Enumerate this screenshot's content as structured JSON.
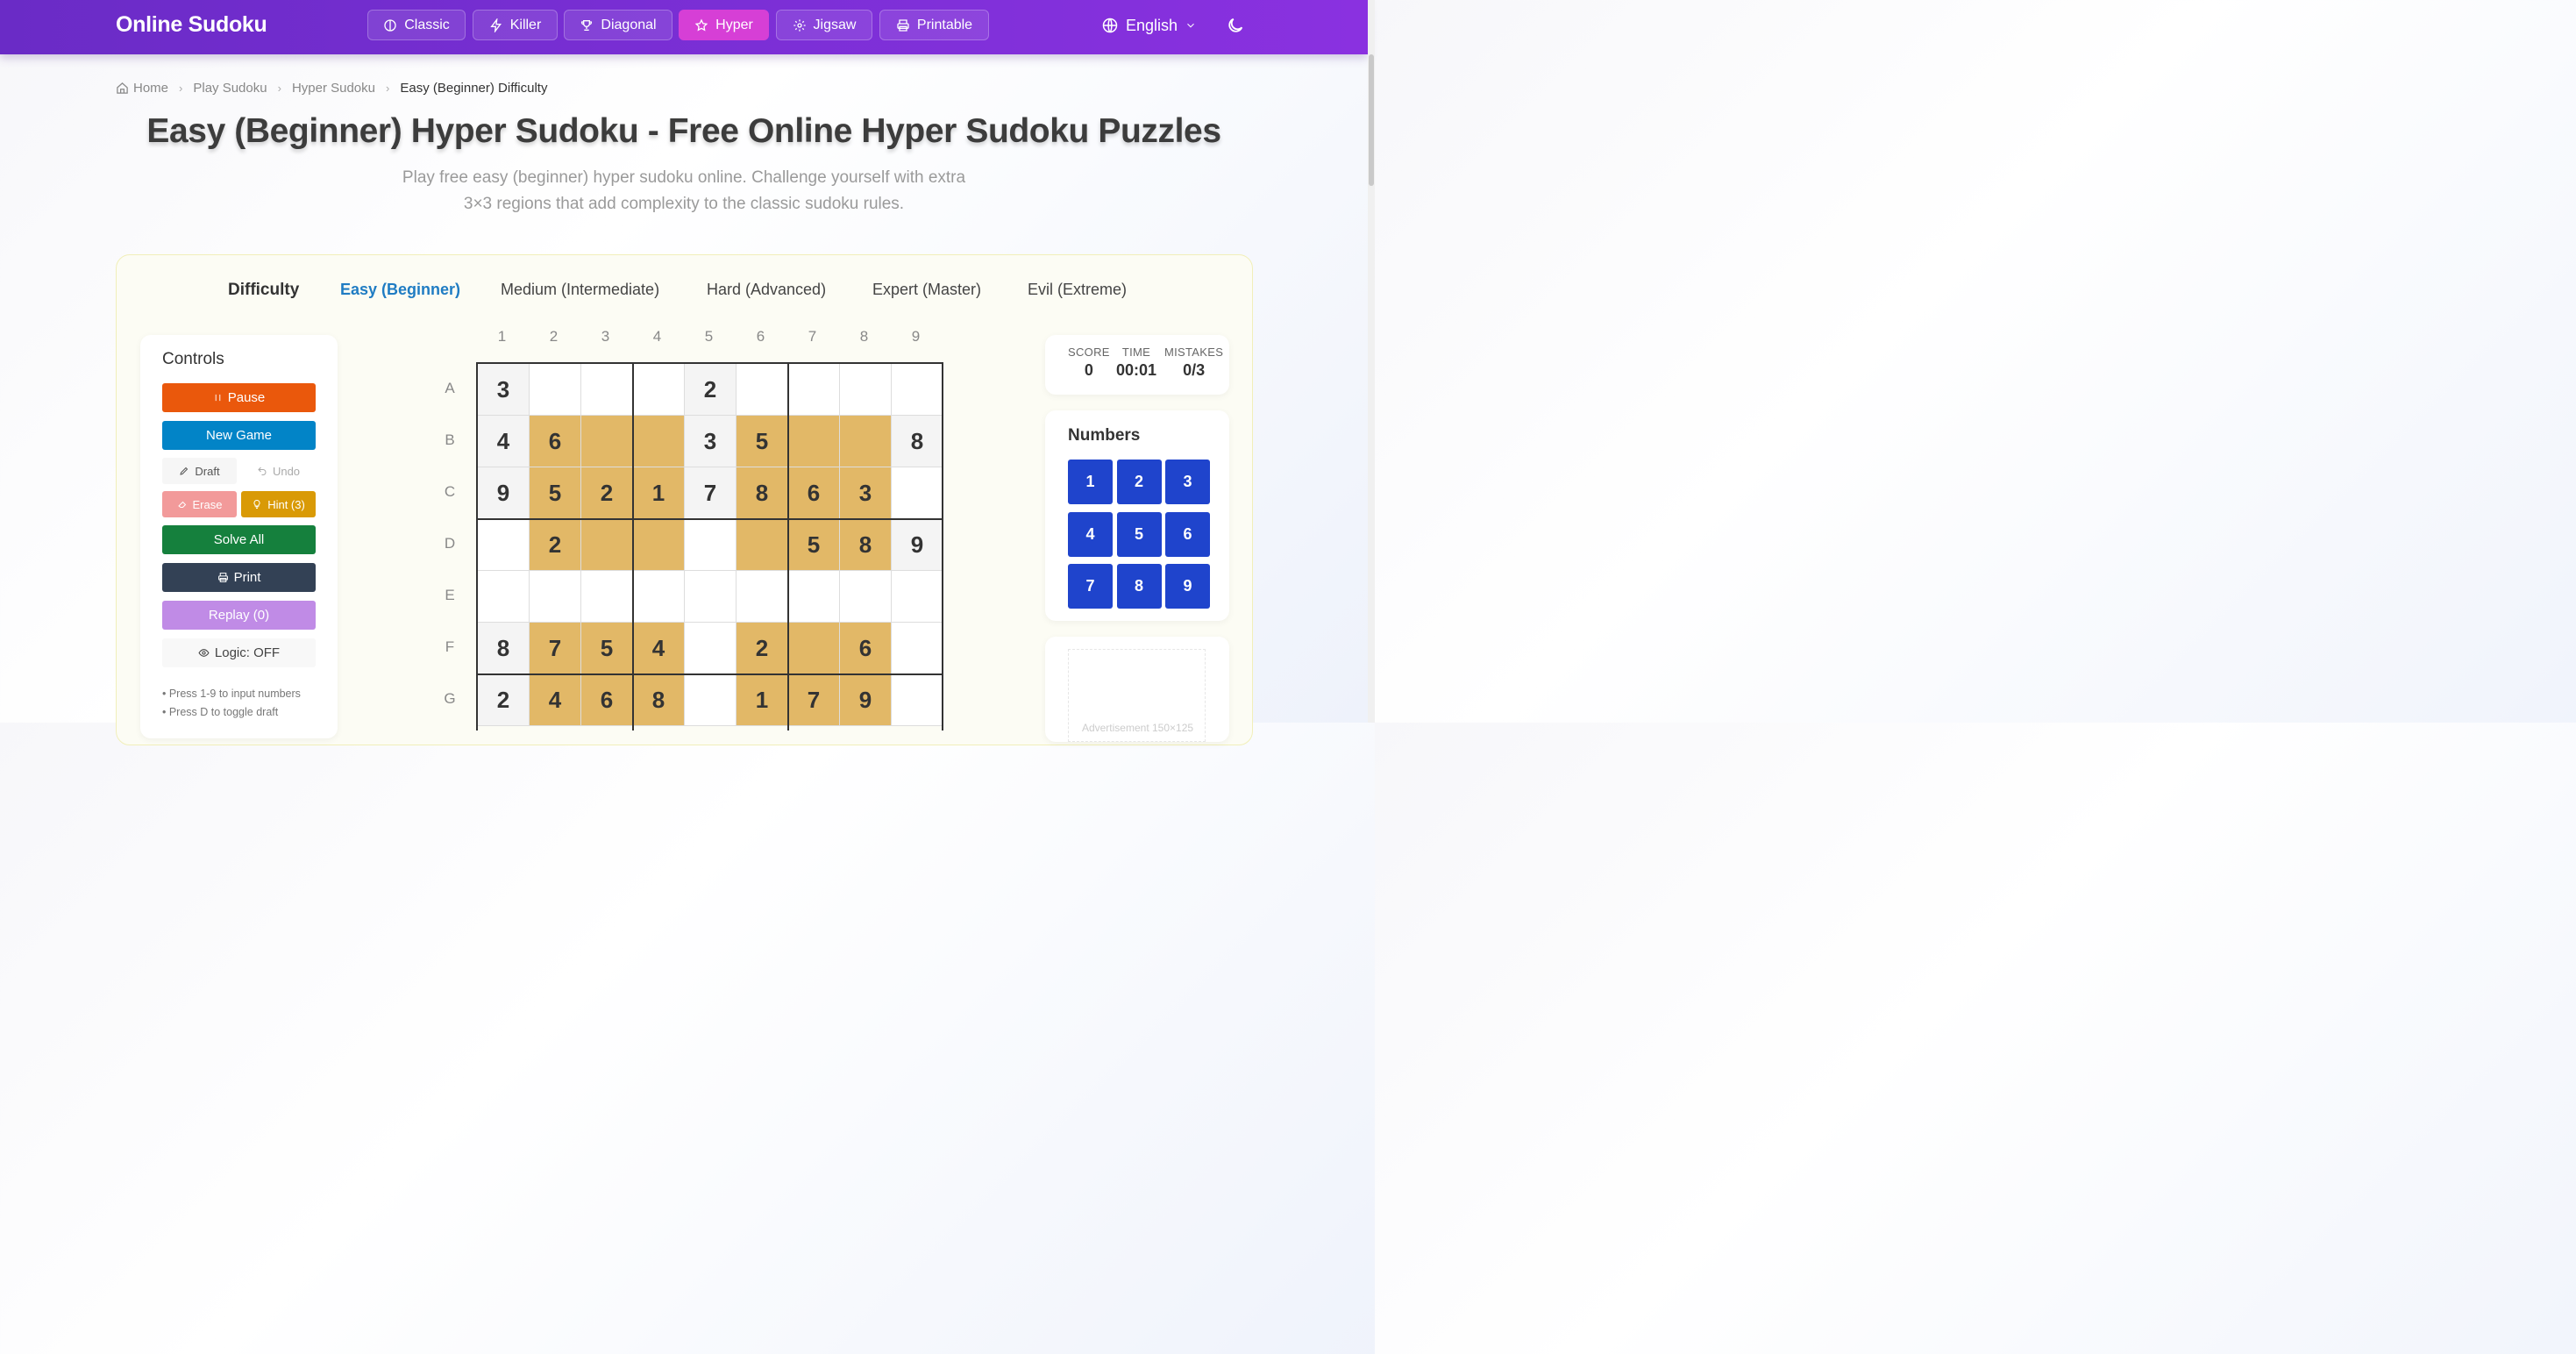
{
  "header": {
    "brand": "Online Sudoku",
    "tabs": [
      {
        "label": "Classic",
        "icon": "circle-half-icon",
        "active": false
      },
      {
        "label": "Killer",
        "icon": "bolt-icon",
        "active": false
      },
      {
        "label": "Diagonal",
        "icon": "trophy-icon",
        "active": false
      },
      {
        "label": "Hyper",
        "icon": "star-icon",
        "active": true
      },
      {
        "label": "Jigsaw",
        "icon": "gear-icon",
        "active": false
      },
      {
        "label": "Printable",
        "icon": "printer-icon",
        "active": false
      }
    ],
    "language": "English",
    "theme_toggle_icon": "moon-icon",
    "accent": "#7b2fd6",
    "active_tab_color": "#d63fd6"
  },
  "breadcrumb": [
    "Home",
    "Play Sudoku",
    "Hyper Sudoku",
    "Easy (Beginner) Difficulty"
  ],
  "page": {
    "title": "Easy (Beginner) Hyper Sudoku - Free Online Hyper Sudoku Puzzles",
    "subtitle_line1": "Play free easy (beginner) hyper sudoku online. Challenge yourself with extra",
    "subtitle_line2": "3×3 regions that add complexity to the classic sudoku rules."
  },
  "difficulty": {
    "label": "Difficulty",
    "options": [
      "Easy (Beginner)",
      "Medium (Intermediate)",
      "Hard (Advanced)",
      "Expert (Master)",
      "Evil (Extreme)"
    ],
    "selected": "Easy (Beginner)"
  },
  "controls": {
    "title": "Controls",
    "pause": "Pause",
    "new_game": "New Game",
    "draft": "Draft",
    "undo": "Undo",
    "erase": "Erase",
    "hint": "Hint (3)",
    "solve_all": "Solve All",
    "print": "Print",
    "replay": "Replay (0)",
    "logic": "Logic: OFF",
    "tips": [
      "• Press 1-9 to input numbers",
      "• Press D to toggle draft"
    ],
    "colors": {
      "pause": "#ea580c",
      "new_game": "#0284c7",
      "erase": "#f29a9a",
      "hint": "#d99a06",
      "solve_all": "#15803d",
      "print": "#334155",
      "replay": "#c08be6"
    }
  },
  "grid": {
    "columns": [
      "1",
      "2",
      "3",
      "4",
      "5",
      "6",
      "7",
      "8",
      "9"
    ],
    "rows": [
      "A",
      "B",
      "C",
      "D",
      "E",
      "F",
      "G"
    ],
    "cells": [
      [
        "3",
        "",
        "",
        "",
        "2",
        "",
        "",
        "",
        ""
      ],
      [
        "4",
        "6",
        "",
        "",
        "3",
        "5",
        "",
        "",
        "8"
      ],
      [
        "9",
        "5",
        "2",
        "1",
        "7",
        "8",
        "6",
        "3",
        ""
      ],
      [
        "",
        "2",
        "",
        "",
        "",
        "",
        "5",
        "8",
        "9"
      ],
      [
        "",
        "",
        "",
        "",
        "",
        "",
        "",
        "",
        ""
      ],
      [
        "8",
        "7",
        "5",
        "4",
        "",
        "2",
        "",
        "6",
        ""
      ],
      [
        "2",
        "4",
        "6",
        "8",
        "",
        "1",
        "7",
        "9",
        ""
      ]
    ],
    "hyper_color": "#e2b867"
  },
  "stats": {
    "score_label": "SCORE",
    "score": "0",
    "time_label": "TIME",
    "time": "00:01",
    "mistakes_label": "MISTAKES",
    "mistakes": "0/3"
  },
  "numbers": {
    "title": "Numbers",
    "keys": [
      "1",
      "2",
      "3",
      "4",
      "5",
      "6",
      "7",
      "8",
      "9"
    ],
    "color": "#1f44cc"
  },
  "ad": {
    "text": "Advertisement 150×125"
  }
}
